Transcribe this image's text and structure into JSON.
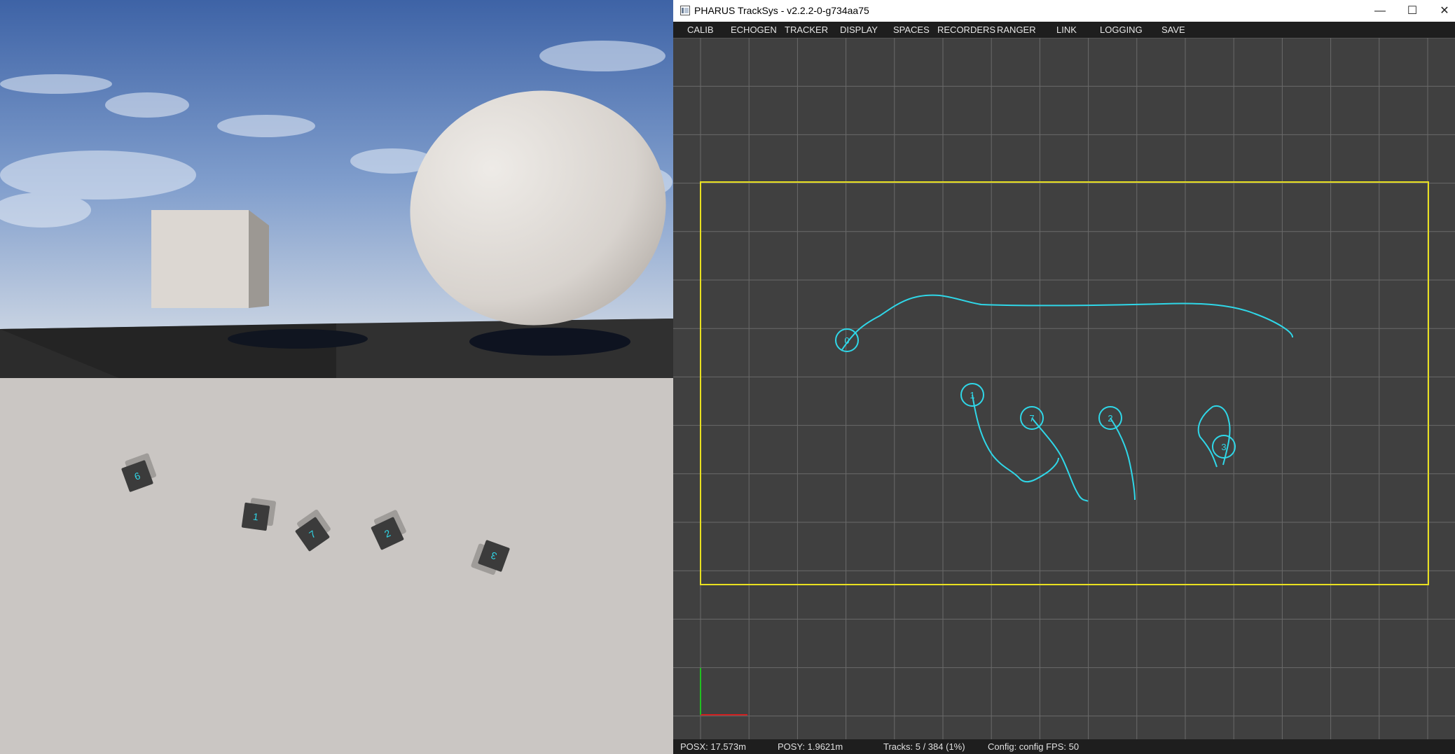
{
  "window": {
    "title": "PHARUS TrackSys - v2.2.2-0-g734aa75",
    "minimize_glyph": "—",
    "maximize_glyph": "☐",
    "close_glyph": "✕",
    "icon": "app-window-icon"
  },
  "menu": [
    "CALIB",
    "ECHOGEN",
    "TRACKER",
    "DISPLAY",
    "SPACES",
    "RECORDERS",
    "RANGER",
    "LINK",
    "LOGGING",
    "SAVE"
  ],
  "tracks": [
    {
      "id": "0"
    },
    {
      "id": "1"
    },
    {
      "id": "7"
    },
    {
      "id": "2"
    },
    {
      "id": "3"
    }
  ],
  "topview_markers": [
    {
      "label": "6"
    },
    {
      "label": "1"
    },
    {
      "label": "7"
    },
    {
      "label": "2"
    },
    {
      "label": "3"
    }
  ],
  "status": {
    "posx": "POSX: 17.573m",
    "posy": "POSY: 1.9621m",
    "tracks": "Tracks: 5 / 384 (1%)",
    "config": "Config: config FPS: 50"
  },
  "colors": {
    "track": "#2fd7e8",
    "boundary": "#e8e020",
    "grid": "#6a6a6a",
    "canvas_bg": "#404040",
    "x_axis": "#d02020",
    "y_axis": "#20c020"
  }
}
